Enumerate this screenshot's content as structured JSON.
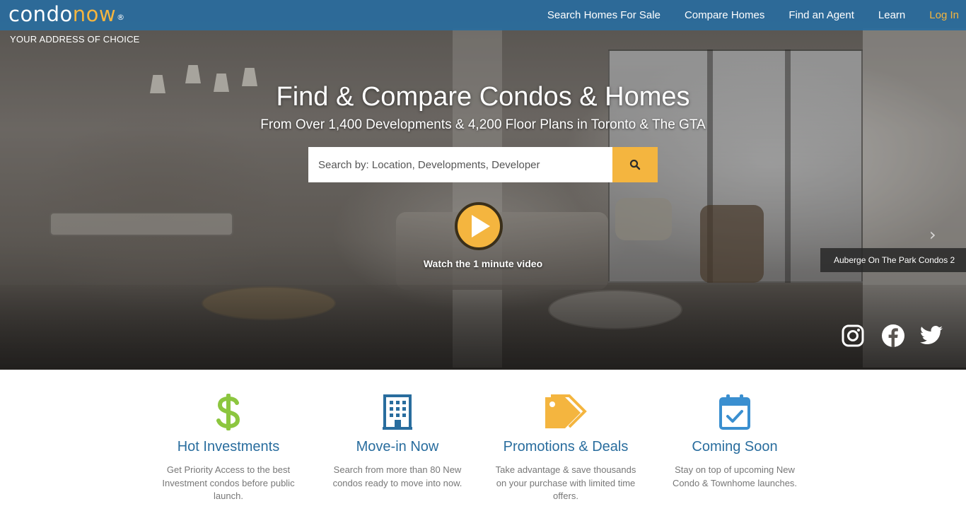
{
  "brand": {
    "logo_part1": "condo",
    "logo_part2": "now",
    "logo_reg": "®",
    "tagline": "YOUR ADDRESS OF CHOICE"
  },
  "nav": {
    "items": [
      {
        "label": "Search Homes For Sale"
      },
      {
        "label": "Compare Homes"
      },
      {
        "label": "Find an Agent"
      },
      {
        "label": "Learn"
      }
    ],
    "login": "Log In"
  },
  "hero": {
    "title": "Find & Compare Condos & Homes",
    "subtitle": "From Over 1,400 Developments & 4,200 Floor Plans in Toronto & The GTA",
    "search_placeholder": "Search by: Location, Developments, Developer",
    "video_label": "Watch the 1 minute video",
    "caption": "Auberge On The Park Condos 2"
  },
  "social": [
    "instagram-icon",
    "facebook-icon",
    "twitter-icon"
  ],
  "features": [
    {
      "icon": "dollar-icon",
      "title": "Hot Investments",
      "desc": "Get Priority Access to the best Investment condos before public launch."
    },
    {
      "icon": "building-icon",
      "title": "Move-in Now",
      "desc": "Search from more than 80 New condos ready to move into now."
    },
    {
      "icon": "tags-icon",
      "title": "Promotions & Deals",
      "desc": "Take advantage & save thousands on your purchase with limited time offers."
    },
    {
      "icon": "calendar-check-icon",
      "title": "Coming Soon",
      "desc": "Stay on top of upcoming New Condo & Townhome launches."
    }
  ],
  "colors": {
    "nav_blue": "#296d9e",
    "accent_yellow": "#f4b53f",
    "dollar_green": "#8cc63f",
    "body_gray": "#777777"
  }
}
